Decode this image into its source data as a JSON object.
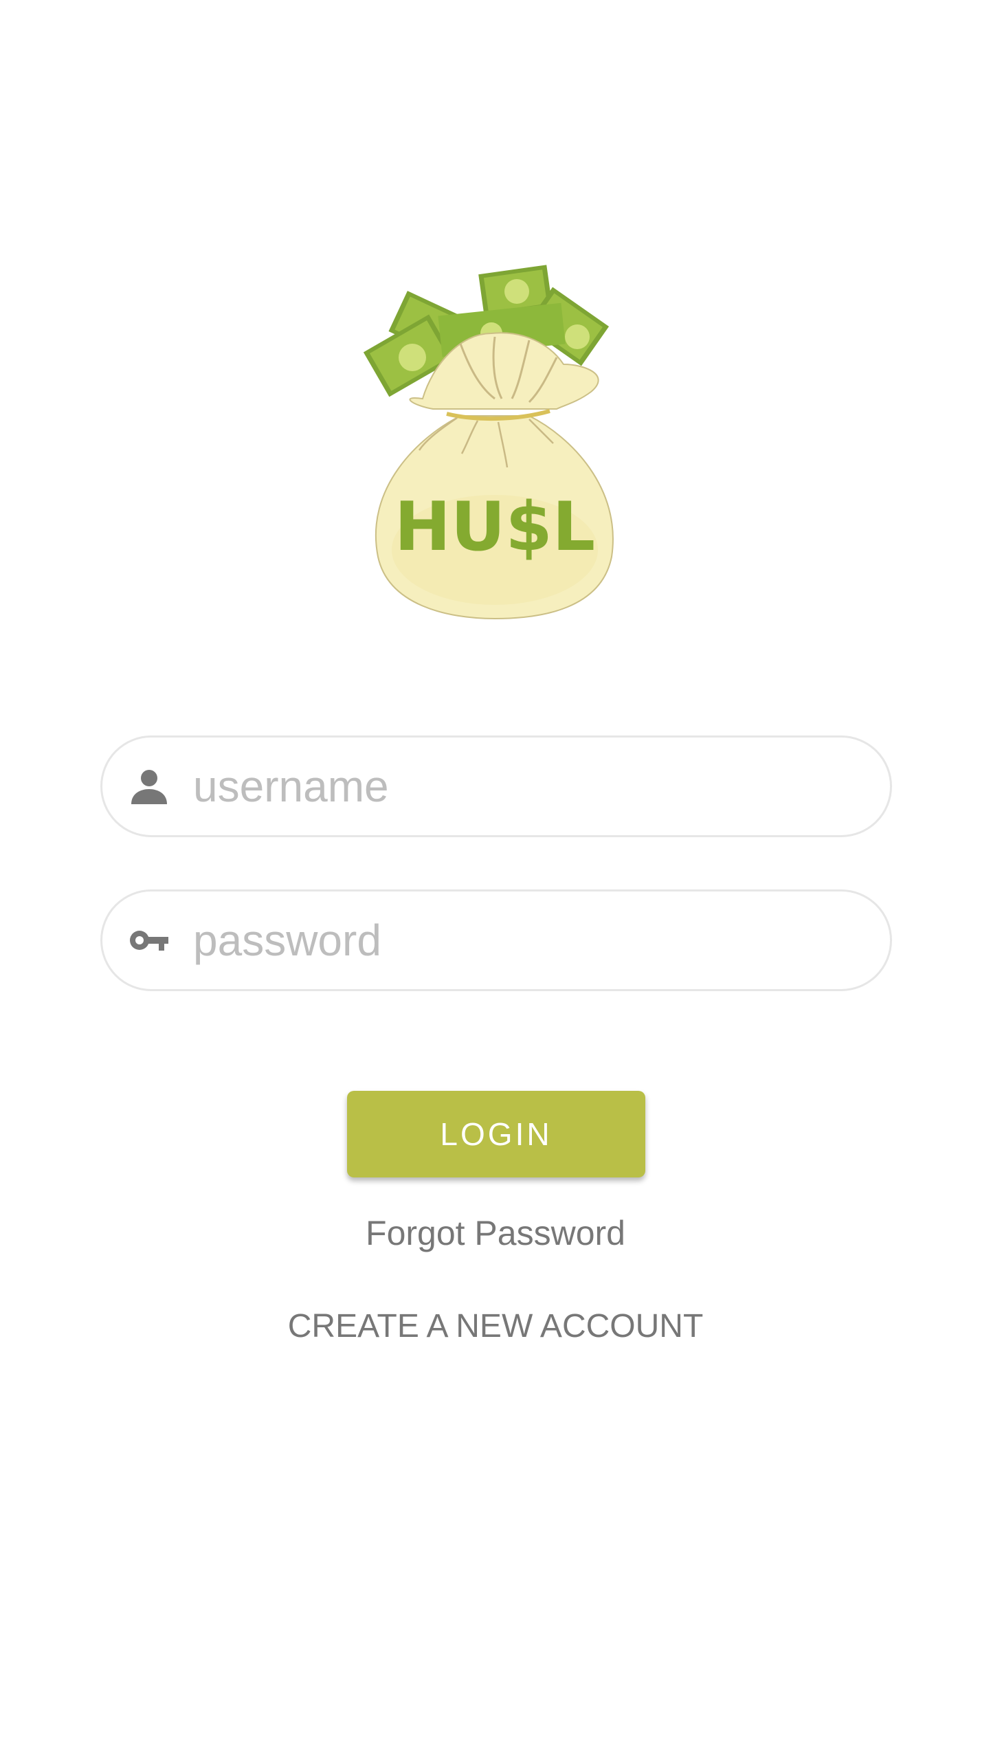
{
  "logo": {
    "text": "HU$L",
    "colors": {
      "bag": "#f6efbe",
      "bag_outline": "#cbbf86",
      "money": "#7ea534",
      "money_light": "#cfe07a",
      "text": "#84aa30"
    }
  },
  "form": {
    "username": {
      "placeholder": "username",
      "value": "",
      "icon": "person-icon"
    },
    "password": {
      "placeholder": "password",
      "value": "",
      "icon": "key-icon"
    }
  },
  "actions": {
    "login_label": "LOGIN",
    "forgot_label": "Forgot Password",
    "create_label": "CREATE A NEW ACCOUNT"
  },
  "theme": {
    "accent": "#b9bf47",
    "muted_text": "#777777",
    "placeholder": "#bdbdbd",
    "field_border": "#e6e6e6"
  }
}
